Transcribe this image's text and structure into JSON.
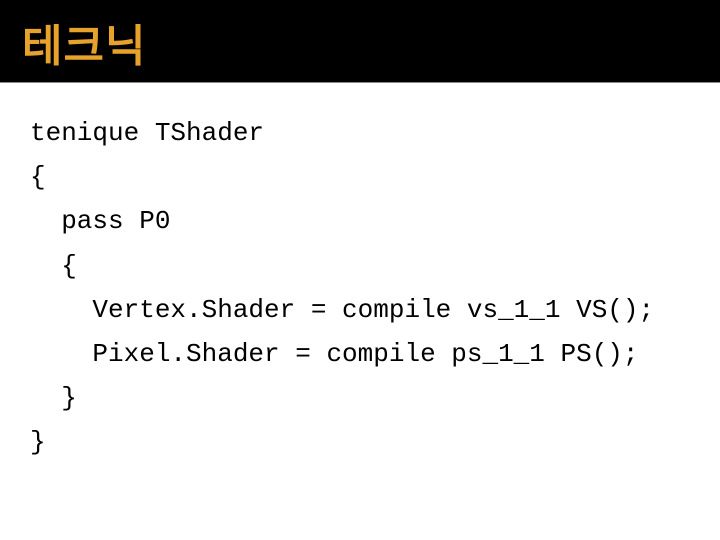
{
  "title": "테크닉",
  "code": {
    "l1": "tenique TShader",
    "l2": "{",
    "l3": "  pass P0",
    "l4": "  {",
    "l5": "    Vertex.Shader = compile vs_1_1 VS();",
    "l6": "    Pixel.Shader = compile ps_1_1 PS();",
    "l7": "  }",
    "l8": "}"
  }
}
